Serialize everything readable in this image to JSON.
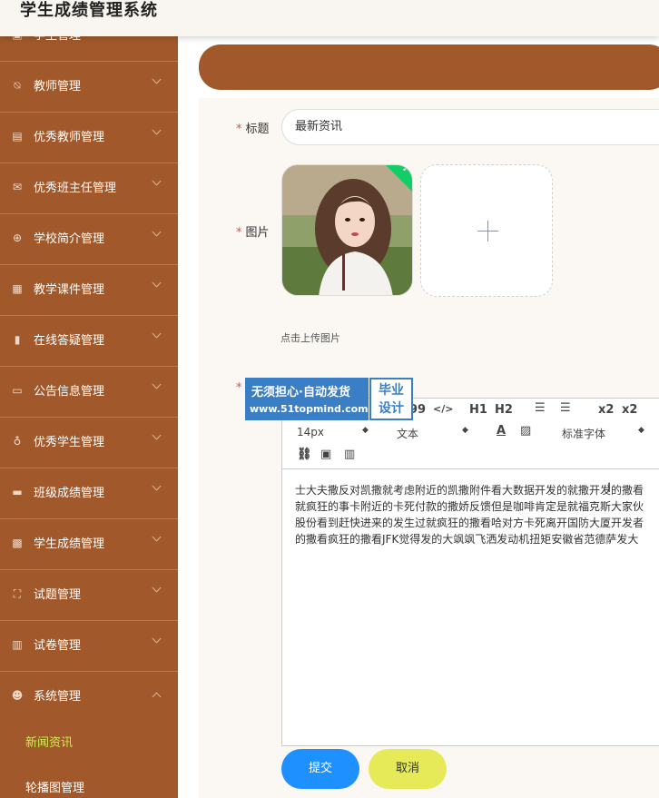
{
  "app": {
    "title": "学生成绩管理系统"
  },
  "sidebar": {
    "items": [
      {
        "label": "学生管理",
        "icon": "picture-icon"
      },
      {
        "label": "教师管理",
        "icon": "bell-off-icon"
      },
      {
        "label": "优秀教师管理",
        "icon": "clipboard-icon"
      },
      {
        "label": "优秀班主任管理",
        "icon": "mail-icon"
      },
      {
        "label": "学校简介管理",
        "icon": "compass-icon"
      },
      {
        "label": "教学课件管理",
        "icon": "grid-icon"
      },
      {
        "label": "在线答疑管理",
        "icon": "bar-chart-icon"
      },
      {
        "label": "公告信息管理",
        "icon": "monitor-icon"
      },
      {
        "label": "优秀学生管理",
        "icon": "microphone-icon"
      },
      {
        "label": "班级成绩管理",
        "icon": "briefcase-icon"
      },
      {
        "label": "学生成绩管理",
        "icon": "apps-icon"
      },
      {
        "label": "试题管理",
        "icon": "fullscreen-icon"
      },
      {
        "label": "试卷管理",
        "icon": "columns-icon"
      },
      {
        "label": "系统管理",
        "icon": "user-icon"
      }
    ],
    "sub_items": [
      {
        "label": "新闻资讯",
        "active": true
      },
      {
        "label": "轮播图管理",
        "active": false
      }
    ]
  },
  "form": {
    "title_label": "标题",
    "title_value": "最新资讯",
    "image_label": "图片",
    "upload_tip": "点击上传图片",
    "content_label": ""
  },
  "editor": {
    "toolbar": {
      "quote": "99",
      "code": "</>",
      "h1": "H1",
      "h2": "H2",
      "sub": "x2",
      "sup": "x2",
      "font_size": "14px",
      "text_type": "文本",
      "font_family": "标准字体"
    },
    "content_lines": [
      "士大夫撒反对凯撒就考虑附近的凯撒附件看大数据开发的就撒开发的撒看",
      "就疯狂的事卡附近的卡死付款的撒娇反馈但是咖啡肯定是就福克斯大家伙",
      "股份看到赶快进来的发生过就疯狂的撒看哈对方卡死离开国防大厦开发者",
      "的撒看疯狂的撒看JFK觉得发的大飒飒飞洒发动机扭矩安徽省范德萨发大"
    ]
  },
  "buttons": {
    "submit": "提交",
    "cancel": "取消"
  },
  "watermark": {
    "line1": "无须担心·自动发货",
    "line2": "www.51topmind.com",
    "badge_line1": "毕业",
    "badge_line2": "设计"
  },
  "colors": {
    "sidebar": "#a1592b",
    "accent_active": "#c5f24e",
    "submit": "#1e90ff",
    "cancel": "#e6e958"
  }
}
